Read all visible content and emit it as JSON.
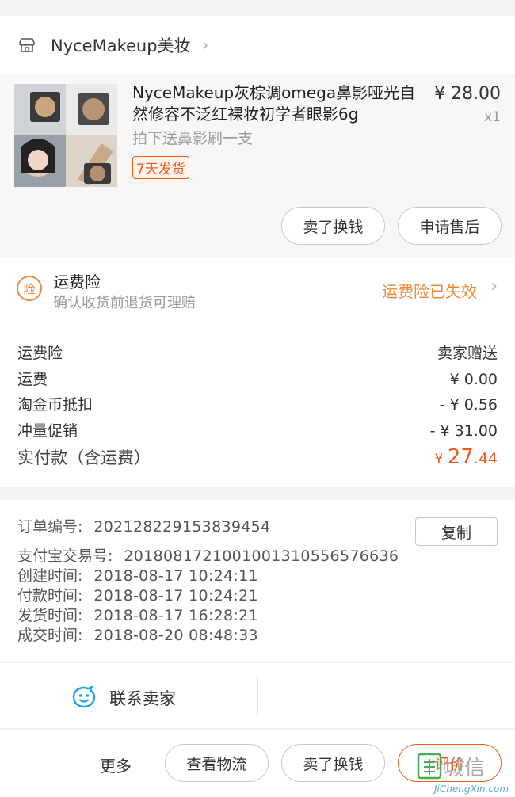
{
  "store": {
    "name": "NyceMakeup美妆",
    "icon": "store-icon"
  },
  "product": {
    "title": "NyceMakeup灰棕调omega鼻影哑光自然修容不泛红裸妆初学者眼影6g",
    "subtitle": "拍下送鼻影刷一支",
    "tag": "7天发货",
    "price": "¥ 28.00",
    "qty": "x1",
    "buttons": {
      "sell": "卖了换钱",
      "after_sale": "申请售后"
    }
  },
  "insurance": {
    "icon_text": "险",
    "title": "运费险",
    "subtitle": "确认收货前退货可理赔",
    "status": "运费险已失效"
  },
  "fees": {
    "rows": [
      {
        "label": "运费险",
        "value": "卖家赠送"
      },
      {
        "label": "运费",
        "value": "¥ 0.00"
      },
      {
        "label": "淘金币抵扣",
        "value": "- ¥ 0.56"
      },
      {
        "label": "冲量促销",
        "value": "- ¥ 31.00"
      }
    ],
    "total_label": "实付款（含运费）",
    "total_currency": "¥ ",
    "total_int": "27",
    "total_dec": ".44"
  },
  "order": {
    "copy_label": "复制",
    "order_no_label": "订单编号:",
    "order_no": "202128229153839454",
    "alipay_label": "支付宝交易号:",
    "alipay_no": "2018081721001001310556576636",
    "created_label": "创建时间:",
    "created": "2018-08-17 10:24:11",
    "paid_label": "付款时间:",
    "paid": "2018-08-17 10:24:21",
    "shipped_label": "发货时间:",
    "shipped": "2018-08-17 16:28:21",
    "deal_label": "成交时间:",
    "deal": "2018-08-20 08:48:33"
  },
  "contact": {
    "label": "联系卖家",
    "icon": "chat-icon"
  },
  "bottom": {
    "more": "更多",
    "logistics": "查看物流",
    "sell": "卖了换钱",
    "review": "评价"
  },
  "watermark": {
    "text": "JiChengXin.com",
    "brand": "城信"
  },
  "colors": {
    "accent": "#f05a1a",
    "insurance": "#f08a3a",
    "contact_icon": "#1aa3e6"
  }
}
